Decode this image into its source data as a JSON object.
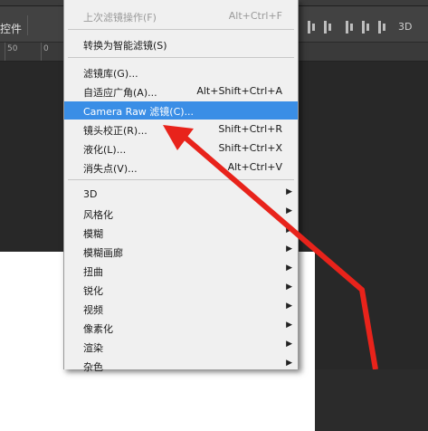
{
  "options_bar": {
    "label": "控件",
    "mode_3d": "3D"
  },
  "ruler": {
    "numbers": [
      "50",
      "0"
    ]
  },
  "filter_menu": {
    "items": [
      {
        "label": "上次滤镜操作(F)",
        "shortcut": "Alt+Ctrl+F",
        "disabled": true
      },
      {
        "label": "转换为智能滤镜(S)",
        "shortcut": ""
      },
      {
        "label": "滤镜库(G)...",
        "shortcut": ""
      },
      {
        "label": "自适应广角(A)...",
        "shortcut": "Alt+Shift+Ctrl+A"
      },
      {
        "label": "Camera Raw 滤镜(C)...",
        "shortcut": "",
        "highlighted": true
      },
      {
        "label": "镜头校正(R)...",
        "shortcut": "Shift+Ctrl+R"
      },
      {
        "label": "液化(L)...",
        "shortcut": "Shift+Ctrl+X"
      },
      {
        "label": "消失点(V)...",
        "shortcut": "Alt+Ctrl+V"
      },
      {
        "label": "3D",
        "submenu": true
      },
      {
        "label": "风格化",
        "submenu": true
      },
      {
        "label": "模糊",
        "submenu": true
      },
      {
        "label": "模糊画廊",
        "submenu": true
      },
      {
        "label": "扭曲",
        "submenu": true
      },
      {
        "label": "锐化",
        "submenu": true
      },
      {
        "label": "视频",
        "submenu": true
      },
      {
        "label": "像素化",
        "submenu": true
      },
      {
        "label": "渲染",
        "submenu": true
      },
      {
        "label": "杂色",
        "submenu": true
      }
    ]
  },
  "colors": {
    "highlight": "#3a8ee6",
    "annotation_arrow": "#e8231b",
    "menu_bg": "#f0f0f0"
  }
}
